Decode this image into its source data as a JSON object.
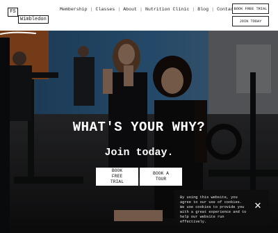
{
  "logo": {
    "initials": "FS",
    "location": "Wimbledon"
  },
  "nav": {
    "items": [
      "Membership",
      "Classes",
      "About",
      "Nutrition Clinic",
      "Blog",
      "Contact"
    ],
    "separator": "|"
  },
  "header_buttons": {
    "free_trial": "BOOK FREE TRIAL",
    "join": "JOIN TODAY"
  },
  "hero": {
    "headline": "WHAT'S YOUR WHY?",
    "subline": "Join today.",
    "cta_free": [
      "BOOK",
      "FREE",
      "TRIAL"
    ],
    "cta_tour": [
      "BOOK A",
      "TOUR"
    ]
  },
  "cookie": {
    "text": "By using this website, you agree to our use of cookies. We use cookies to provide you with a great experience and to help our website run effectively.",
    "close_icon": "close-icon"
  },
  "colors": {
    "header_bg": "#ffffff",
    "hero_overlay": "#1e1f22",
    "cookie_bg": "#0e0e0e",
    "accent": "#e8792c"
  }
}
